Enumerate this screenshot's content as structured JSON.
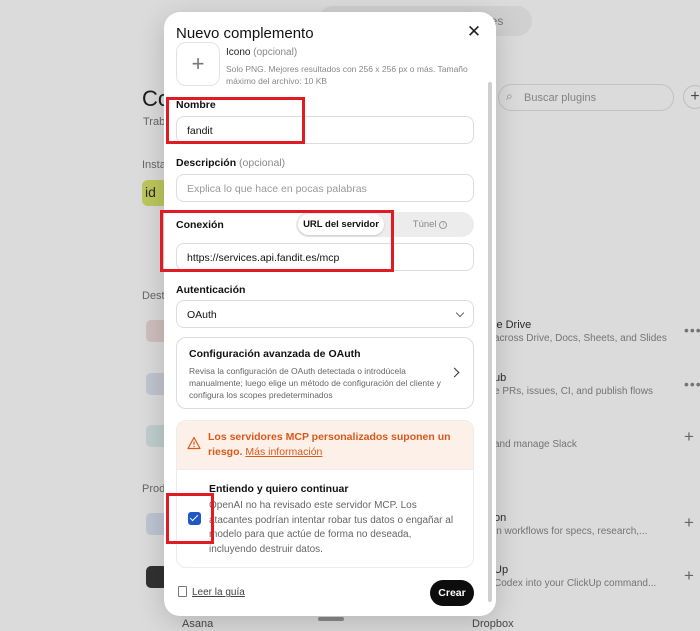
{
  "background": {
    "tab_right_label": "les",
    "title": "Co",
    "subtitle": "Trab",
    "installed_label": "Insta",
    "installed_item_letters": "id",
    "featured_label": "Dest",
    "products_label": "Prod",
    "search_placeholder": "Buscar plugins",
    "rows": [
      {
        "title": "le Drive",
        "desc": "across Drive, Docs, Sheets, and Slides"
      },
      {
        "title": "ub",
        "desc": "e PRs, issues, CI, and publish flows"
      },
      {
        "title": "",
        "desc": "and manage Slack"
      },
      {
        "title": "on",
        "desc": "in workflows for specs, research,..."
      },
      {
        "title": "Up",
        "desc": "Codex into your ClickUp command..."
      }
    ],
    "asana_label": "Asana",
    "dropbox_label": "Dropbox"
  },
  "modal": {
    "title": "Nuevo complemento",
    "icon_label": "Icono",
    "icon_optional": "(opcional)",
    "icon_hint": "Solo PNG. Mejores resultados con 256 x 256 px o más. Tamaño máximo del archivo: 10 KB",
    "name_label": "Nombre",
    "name_value": "fandit",
    "description_label": "Descripción",
    "description_optional": "(opcional)",
    "description_placeholder": "Explica lo que hace en pocas palabras",
    "connection_label": "Conexión",
    "connection_tab_active": "URL del servidor",
    "connection_tab_inactive": "Túnel",
    "connection_url": "https://services.api.fandit.es/mcp",
    "auth_label": "Autenticación",
    "auth_value": "OAuth",
    "advanced_title": "Configuración avanzada de OAuth",
    "advanced_desc": "Revisa la configuración de OAuth detectada o introdúcela manualmente; luego elige un método de configuración del cliente y configura los scopes predeterminados",
    "risk_title": "Los servidores MCP personalizados suponen un riesgo.",
    "risk_more": "Más información",
    "ack_title": "Entiendo y quiero continuar",
    "ack_desc": "OpenAI no ha revisado este servidor MCP. Los atacantes podrían intentar robar tus datos o engañar al modelo para que actúe de forma no deseada, incluyendo destruir datos.",
    "ack_checked": true,
    "guide_link": "Leer la guía",
    "create_button": "Crear"
  },
  "colors": {
    "annotation": "#e01b24",
    "warning": "#d9591b",
    "checkbox": "#1f57c4"
  }
}
